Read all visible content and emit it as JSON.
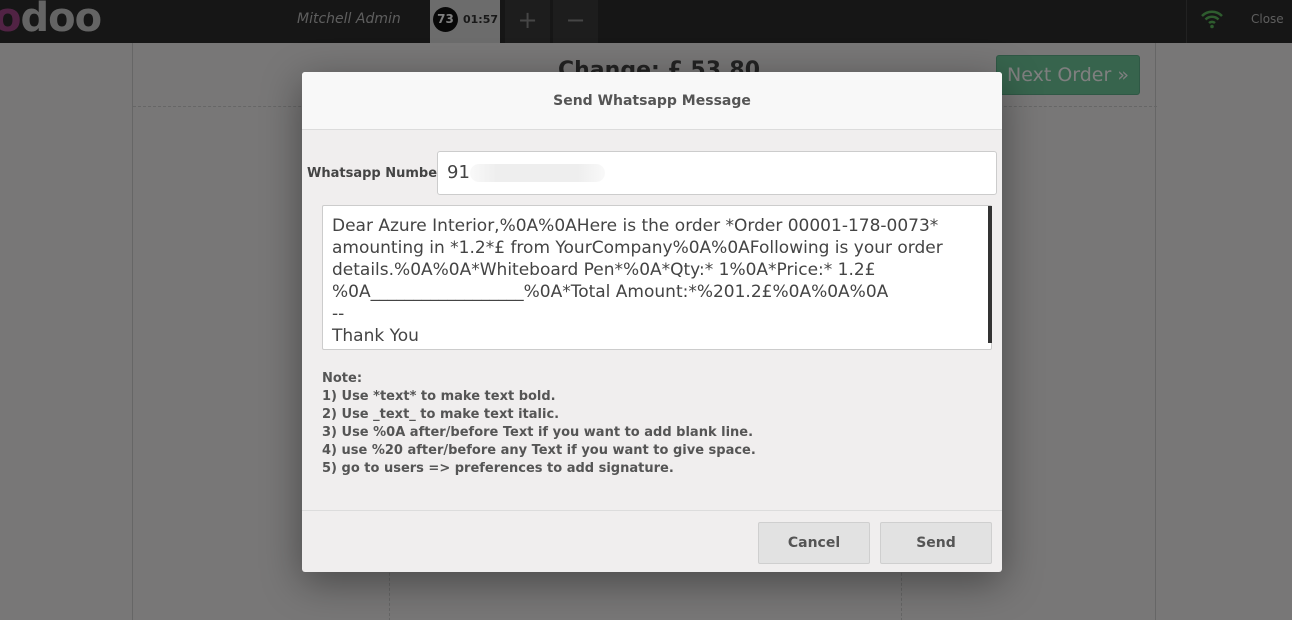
{
  "navbar": {
    "logo_text": "odoo",
    "user_name": "Mitchell Admin",
    "order": {
      "number": "73",
      "time": "01:57"
    },
    "add_order_label": "+",
    "remove_order_label": "−",
    "close_label": "Close"
  },
  "background": {
    "change_text": "Change: £ 53.80",
    "next_order_label": "Next Order »"
  },
  "modal": {
    "title": "Send Whatsapp Message",
    "number_label": "Whatsapp Number",
    "number_value": "91",
    "message": "Dear Azure Interior,%0A%0AHere is the order *Order 00001-178-0073* amounting in *1.2*£ from YourCompany%0A%0AFollowing is your order details.%0A%0A*Whiteboard Pen*%0A*Qty:* 1%0A*Price:* 1.2£ %0A__________________%0A*Total Amount:*%201.2£%0A%0A%0A\n--\nThank You",
    "notes": [
      "Note:",
      "1) Use *text* to make text bold.",
      "2) Use _text_ to make text italic.",
      "3) Use %0A after/before Text if you want to add blank line.",
      "4) use %20 after/before any Text if you want to give space.",
      "5) go to users => preferences to add signature."
    ],
    "cancel_label": "Cancel",
    "send_label": "Send"
  }
}
